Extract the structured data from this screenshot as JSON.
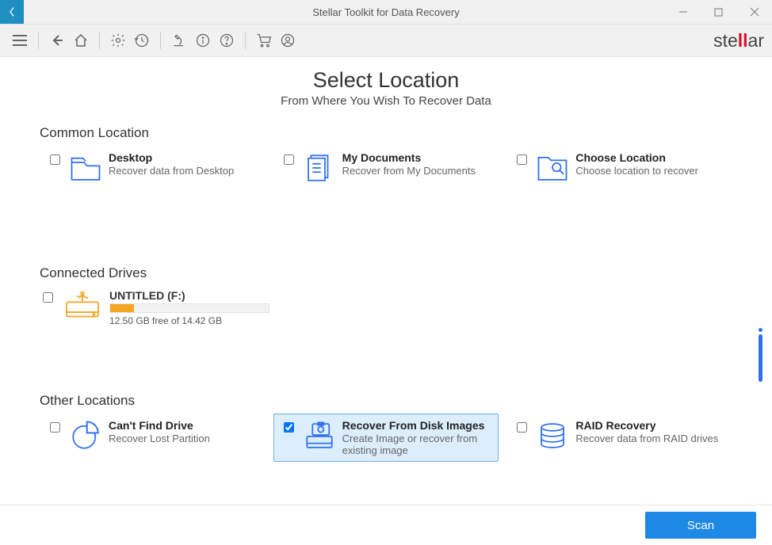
{
  "window": {
    "title": "Stellar Toolkit for Data Recovery"
  },
  "brand": {
    "pre": "ste",
    "accent": "ll",
    "post": "ar"
  },
  "header": {
    "title": "Select Location",
    "subtitle": "From Where You Wish To Recover Data"
  },
  "sections": {
    "common": "Common Location",
    "drives": "Connected Drives",
    "other": "Other Locations"
  },
  "common": [
    {
      "label": "Desktop",
      "sub": "Recover data from Desktop",
      "checked": false,
      "icon": "folder-icon",
      "name": "option-desktop"
    },
    {
      "label": "My Documents",
      "sub": "Recover from My Documents",
      "checked": false,
      "icon": "documents-icon",
      "name": "option-my-documents"
    },
    {
      "label": "Choose Location",
      "sub": "Choose location to recover",
      "checked": false,
      "icon": "search-folder-icon",
      "name": "option-choose-location"
    }
  ],
  "drives": [
    {
      "label": "UNTITLED (F:)",
      "free": "12.50 GB free of 14.42 GB",
      "used_pct": 15,
      "checked": false,
      "name": "drive-f"
    }
  ],
  "other": [
    {
      "label": "Can't Find Drive",
      "sub": "Recover Lost Partition",
      "checked": false,
      "icon": "pie-icon",
      "name": "option-cant-find-drive"
    },
    {
      "label": "Recover From Disk Images",
      "sub": "Create Image or recover from existing image",
      "checked": true,
      "icon": "disk-image-icon",
      "name": "option-disk-images"
    },
    {
      "label": "RAID Recovery",
      "sub": "Recover data from RAID drives",
      "checked": false,
      "icon": "raid-icon",
      "name": "option-raid"
    }
  ],
  "footer": {
    "scan": "Scan"
  }
}
